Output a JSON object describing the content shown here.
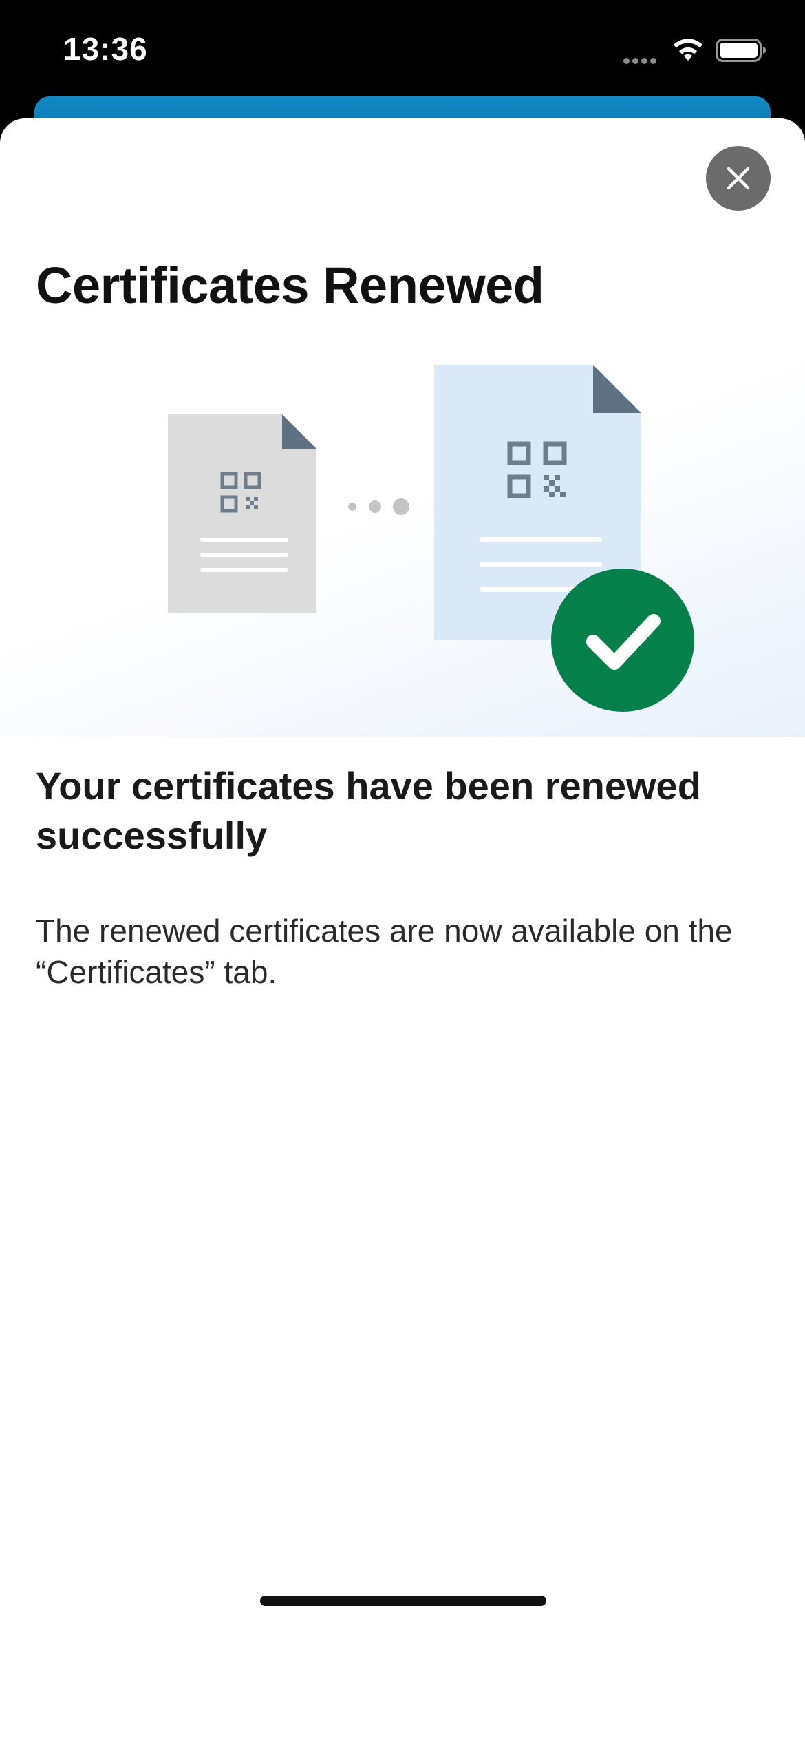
{
  "status_bar": {
    "time": "13:36"
  },
  "sheet": {
    "title": "Certificates Renewed",
    "close_icon": "close-icon",
    "headline": "Your certificates have been renewed successfully",
    "body": "The renewed certificates are now available on the “Certificates” tab."
  },
  "illustration": {
    "old_document_icon": "qr-document-icon",
    "new_document_icon": "qr-document-icon",
    "progress_dots_icon": "progress-dots-icon",
    "success_icon": "checkmark-circle-icon"
  },
  "colors": {
    "accent_blue": "#1189c4",
    "success_green": "#06804b",
    "close_button_gray": "#6b6b6b",
    "old_document_gray": "#dcdcdc",
    "new_document_blue": "#d9e9f8",
    "document_fold": "#667788"
  }
}
